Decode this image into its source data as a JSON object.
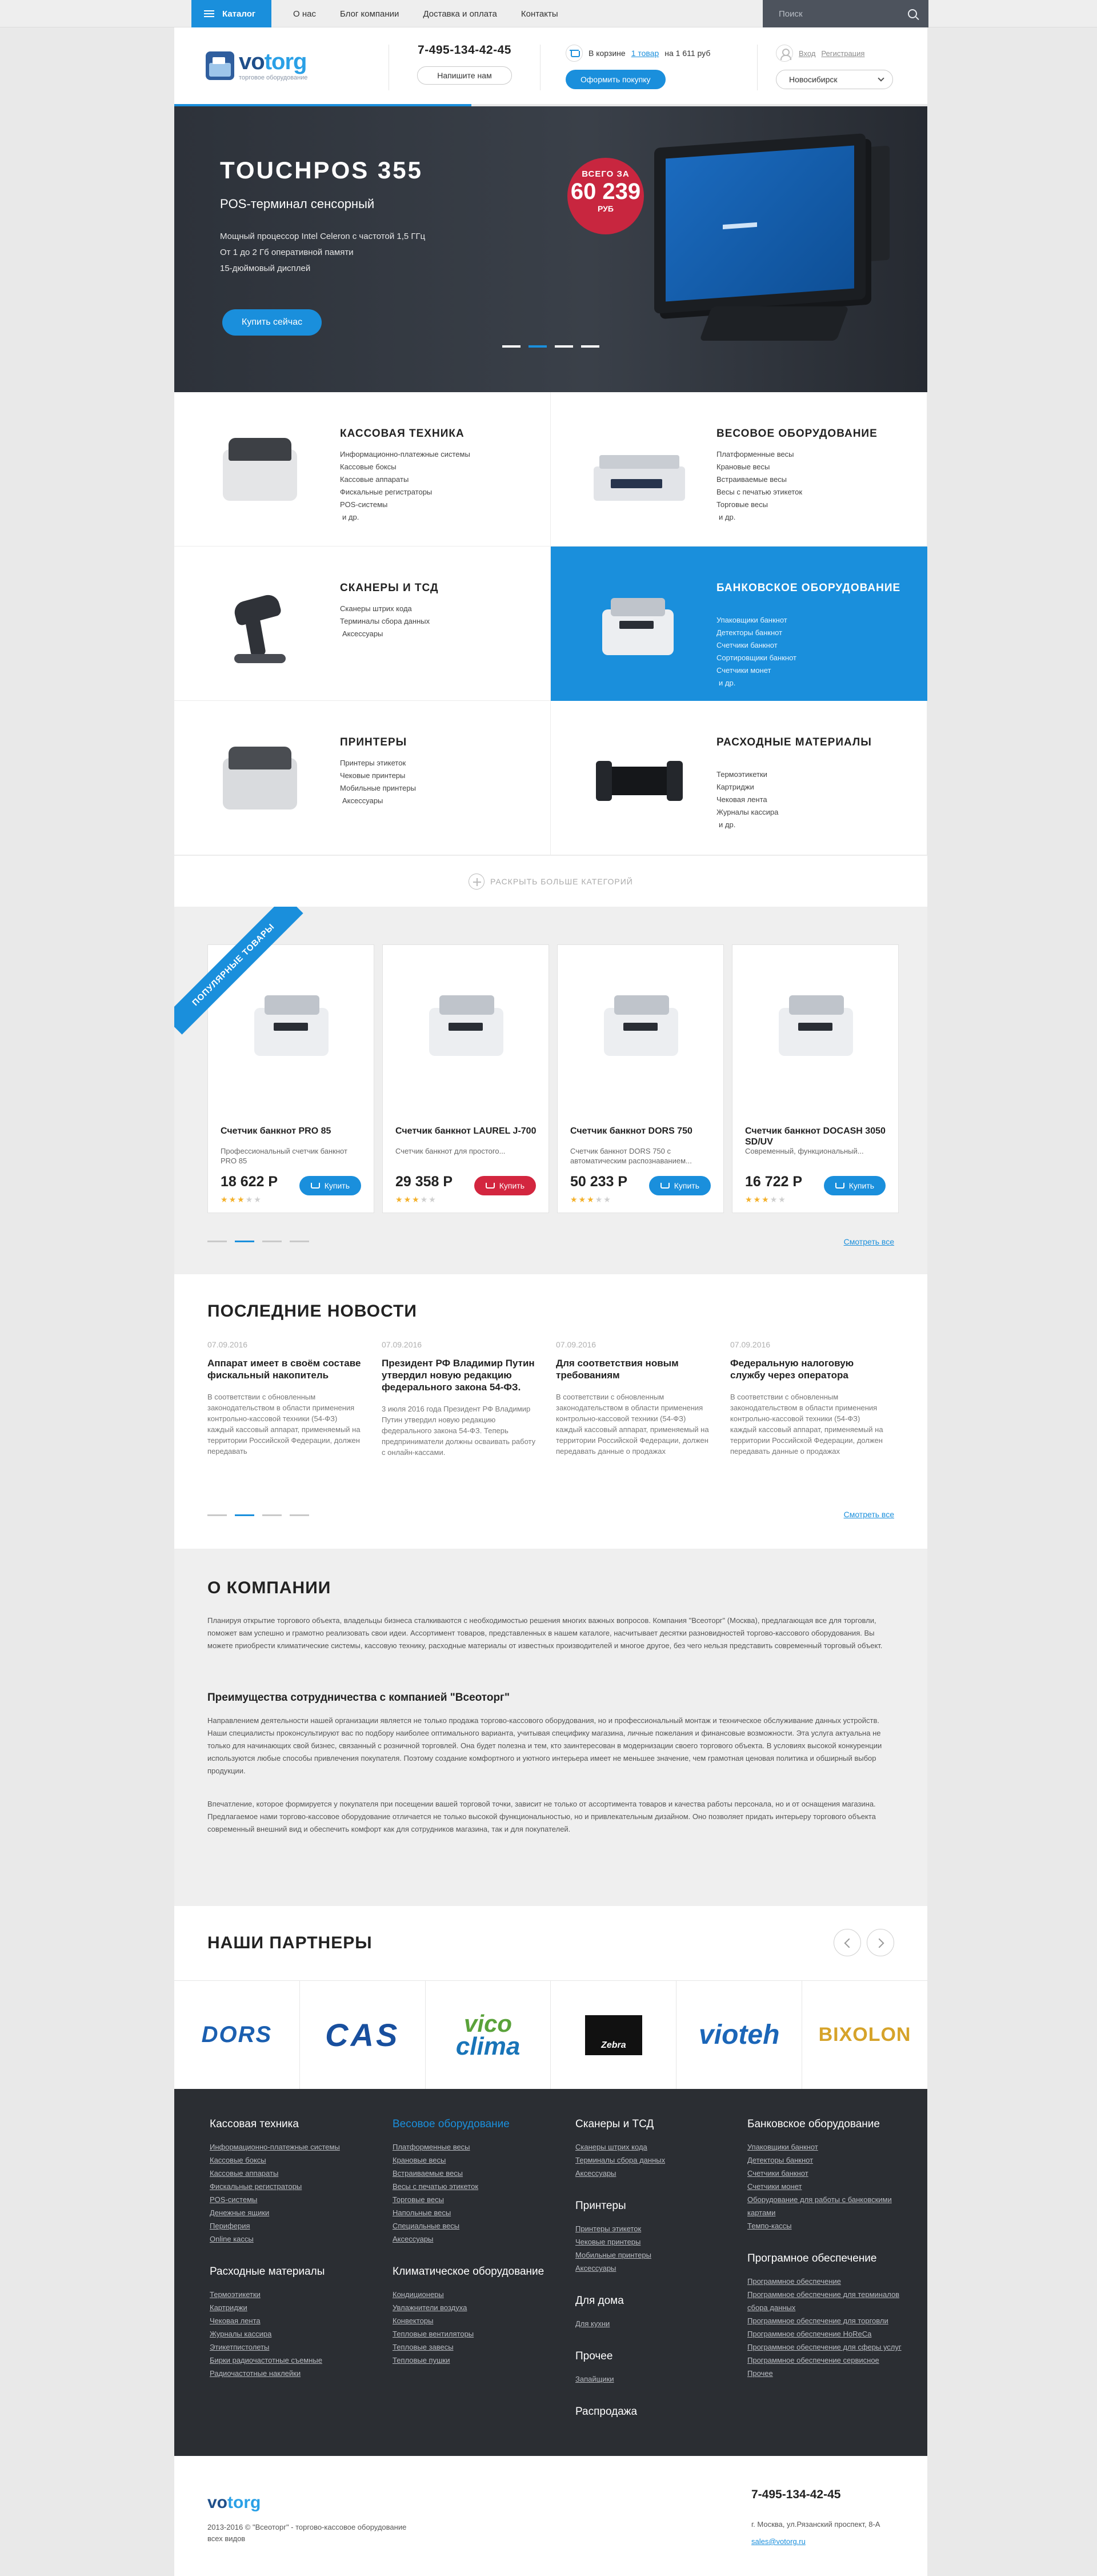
{
  "topbar": {
    "catalog": "Каталог",
    "nav": [
      "О нас",
      "Блог компании",
      "Доставка и оплата",
      "Контакты"
    ],
    "search_placeholder": "Поиск"
  },
  "header": {
    "logo_text_a": "vo",
    "logo_text_b": "torg",
    "logo_sub": "торговое оборудование",
    "phone": "7-495-134-42-45",
    "callback": "Напишите нам",
    "cart_prefix": "В корзине",
    "cart_count": "1 товар",
    "cart_sum": "на 1 611 руб",
    "checkout": "Оформить покупку",
    "login": "Вход",
    "register": "Регистрация",
    "city": "Новосибирск"
  },
  "hero": {
    "title": "TOUCHPOS 355",
    "subtitle": "POS-терминал сенсорный",
    "features": [
      "Мощный процессор Intel Celeron с частотой 1,5 ГГц",
      "От 1 до 2 Гб оперативной памяти",
      "15-дюймовый дисплей"
    ],
    "cta": "Купить сейчас",
    "badge_top": "ВСЕГО ЗА",
    "badge_price": "60 239",
    "badge_cur": "РУБ",
    "active_slide": 2,
    "slides": 4
  },
  "categories": [
    {
      "title": "Кассовая техника",
      "items": [
        "Информационно-платежные системы",
        "Кассовые боксы",
        "Кассовые аппараты",
        "Фискальные регистраторы",
        "POS-системы",
        "и др."
      ]
    },
    {
      "title": "Весовое оборудование",
      "items": [
        "Платформенные весы",
        "Крановые весы",
        "Встраиваемые весы",
        "Весы с печатью этикеток",
        "Торговые весы",
        "и др."
      ]
    },
    {
      "title": "Сканеры и ТСД",
      "items": [
        "Сканеры штрих кода",
        "Терминалы сбора данных",
        "Аксессуары"
      ]
    },
    {
      "title": "Банковское оборудование",
      "items": [
        "Упаковщики банкнот",
        "Детекторы банкнот",
        "Счетчики банкнот",
        "Сортировщики банкнот",
        "Счетчики монет",
        "и др."
      ]
    },
    {
      "title": "Принтеры",
      "items": [
        "Принтеры этикеток",
        "Чековые принтеры",
        "Мобильные принтеры",
        "Аксессуары"
      ]
    },
    {
      "title": "Расходные материалы",
      "items": [
        "Термоэтикетки",
        "Картриджи",
        "Чековая лента",
        "Журналы кассира",
        "и др."
      ]
    }
  ],
  "more_categories": "Раскрыть больше категорий",
  "popular": {
    "ribbon": "Популярные товары",
    "see_all": "Смотреть все",
    "active_dot": 1,
    "products": [
      {
        "name": "Счетчик банкнот PRO 85",
        "desc": "Профессиональный счетчик банкнот PRO 85",
        "price": "18 622 Р",
        "rating": 3,
        "buy": "Купить",
        "accent": "#1a8fdc"
      },
      {
        "name": "Счетчик банкнот LAUREL J-700",
        "desc": "Счетчик банкнот для простого...",
        "price": "29 358 Р",
        "rating": 3,
        "buy": "Купить",
        "accent": "#d3263f"
      },
      {
        "name": "Счетчик банкнот DORS 750",
        "desc": "Счетчик банкнот DORS 750 с автоматическим распознаванием...",
        "price": "50 233 Р",
        "rating": 3,
        "buy": "Купить",
        "accent": "#1a8fdc"
      },
      {
        "name": "Счетчик банкнот DOCASH 3050 SD/UV",
        "desc": "Современный, функциональный...",
        "price": "16 722 Р",
        "rating": 3,
        "buy": "Купить",
        "accent": "#1a8fdc"
      }
    ]
  },
  "news": {
    "title": "Последние новости",
    "see_all": "Смотреть все",
    "active_dot": 1,
    "items": [
      {
        "date": "07.09.2016",
        "title": "Аппарат имеет в своём составе фискальный накопитель",
        "text": "В соответствии с обновленным законодательством в области применения контрольно-кассовой техники (54-ФЗ) каждый кассовый аппарат, применяемый на территории Российской Федерации, должен передавать"
      },
      {
        "date": "07.09.2016",
        "title": "Президент РФ Владимир Путин утвердил новую редакцию федерального закона 54-ФЗ.",
        "text": "3 июля 2016 года Президент РФ Владимир Путин утвердил новую редакцию федерального закона 54-ФЗ. Теперь предприниматели должны осваивать работу с онлайн-кассами."
      },
      {
        "date": "07.09.2016",
        "title": "Для соответствия новым требованиям",
        "text": "В соответствии с обновленным законодательством в области применения контрольно-кассовой техники (54-ФЗ) каждый кассовый аппарат, применяемый на территории Российской Федерации, должен передавать данные о продажах"
      },
      {
        "date": "07.09.2016",
        "title": "Федеральную налоговую службу через оператора",
        "text": "В соответствии с обновленным законодательством в области применения контрольно-кассовой техники (54-ФЗ) каждый кассовый аппарат, применяемый на территории Российской Федерации, должен передавать данные о продажах"
      }
    ]
  },
  "about": {
    "title": "О компании",
    "p1": "Планируя открытие торгового объекта, владельцы бизнеса сталкиваются с необходимостью решения многих важных вопросов. Компания \"Всеоторг\" (Москва), предлагающая все для торговли, поможет вам успешно и грамотно реализовать свои идеи. Ассортимент товаров, представленных в нашем каталоге, насчитывает десятки разновидностей торгово-кассового оборудования. Вы можете приобрести климатические системы, кассовую технику, расходные материалы от известных производителей и многое другое, без чего нельзя представить современный торговый объект.",
    "subtitle": "Преимущества сотрудничества с компанией \"Всеоторг\"",
    "p2": "Направлением деятельности нашей организации является не только продажа торгово-кассового оборудования, но и профессиональный монтаж и техническое обслуживание данных устройств. Наши специалисты проконсультируют вас по подбору наиболее оптимального варианта, учитывая специфику магазина, личные пожелания и финансовые возможности. Эта услуга актуальна не только для начинающих свой бизнес, связанный с розничной торговлей. Она будет полезна и тем, кто заинтересован в модернизации своего торгового объекта. В условиях высокой конкуренции используются любые способы привлечения покупателя. Поэтому создание комфортного и уютного интерьера имеет не меньшее значение, чем грамотная ценовая политика и обширный выбор продукции.",
    "p3": "Впечатление, которое формируется у покупателя при посещении вашей торговой точки, зависит не только от ассортимента товаров и качества работы персонала, но и от оснащения магазина. Предлагаемое нами торгово-кассовое оборудование отличается не только высокой функциональностью, но и привлекательным дизайном. Оно позволяет придать интерьеру торгового объекта современный внешний вид и обеспечить комфорт как для сотрудников магазина, так и для покупателей."
  },
  "partners": {
    "title": "Наши партнеры",
    "logos": [
      "DORS",
      "CAS",
      "vico",
      "clima",
      "Zebra",
      "vioteh",
      "BIXOLON"
    ]
  },
  "footer": {
    "col1": [
      {
        "title": "Кассовая техника",
        "items": [
          "Информационно-платежные системы",
          "Кассовые боксы",
          "Кассовые аппараты",
          "Фискальные регистраторы",
          "POS-системы",
          "Денежные ящики",
          "Периферия",
          "Online кассы"
        ]
      },
      {
        "title": "Расходные материалы",
        "items": [
          "Термоэтикетки",
          "Картриджи",
          "Чековая лента",
          "Журналы кассира",
          "Этикетпистолеты",
          "Бирки радиочастотные съемные",
          "Радиочастотные наклейки"
        ]
      }
    ],
    "col2": [
      {
        "title": "Весовое оборудование",
        "items": [
          "Платформенные весы",
          "Крановые весы",
          "Встраиваемые весы",
          "Весы с печатью этикеток",
          "Торговые весы",
          "Напольные весы",
          "Специальные весы",
          "Аксессуары"
        ]
      },
      {
        "title": "Климатическое оборудование",
        "items": [
          "Кондиционеры",
          "Увлажнители воздуха",
          "Конвекторы",
          "Тепловые вентиляторы",
          "Тепловые завесы",
          "Тепловые пушки"
        ]
      }
    ],
    "col3": [
      {
        "title": "Сканеры и ТСД",
        "items": [
          "Сканеры штрих кода",
          "Терминалы сбора данных",
          "Аксессуары"
        ]
      },
      {
        "title": "Принтеры",
        "items": [
          "Принтеры этикеток",
          "Чековые принтеры",
          "Мобильные принтеры",
          "Аксессуары"
        ]
      },
      {
        "title": "Для дома",
        "items": [
          "Для кухни"
        ]
      },
      {
        "title": "Прочее",
        "items": [
          "Запайщики"
        ]
      },
      {
        "title": "Распродажа",
        "items": []
      }
    ],
    "col4": [
      {
        "title": "Банковское оборудование",
        "items": [
          "Упаковщики банкнот",
          "Детекторы банкнот",
          "Счетчики банкнот",
          "Счетчики монет",
          "Оборудование для работы с банковскими картами",
          "Темпо-кассы"
        ]
      },
      {
        "title": "Програмное обеспечение",
        "items": [
          "Программное обеспечение",
          "Программное обеспечение для терминалов сбора данных",
          "Программное обеспечение для торговли",
          "Программное обеспечение HoReCa",
          "Программное обеспечение для сферы услуг",
          "Программное обеспечение сервисное",
          "Прочее"
        ]
      }
    ]
  },
  "bottom": {
    "logo_a": "vo",
    "logo_b": "torg",
    "copyright": "2013-2016 © \"Всеоторг\" - торгово-кассовое оборудование всех видов",
    "phone": "7-495-134-42-45",
    "address": "г. Москва, ул.Рязанский проспект, 8-А",
    "email": "sales@votorg.ru"
  }
}
